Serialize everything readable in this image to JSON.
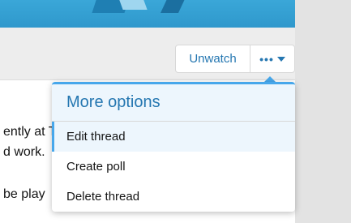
{
  "thread_actions": {
    "unwatch_label": "Unwatch",
    "more_icon": "ellipsis-icon",
    "dropdown_icon": "caret-down-icon"
  },
  "post_fragments": [
    "ently at T",
    "d work.",
    "be play"
  ],
  "more_menu": {
    "title": "More options",
    "items": [
      {
        "label": "Edit thread",
        "active": true
      },
      {
        "label": "Create poll",
        "active": false
      },
      {
        "label": "Delete thread",
        "active": false
      }
    ]
  },
  "colors": {
    "accent": "#2577b1",
    "menu_highlight": "#47a7eb",
    "menu_header_bg": "#edf6fd"
  }
}
